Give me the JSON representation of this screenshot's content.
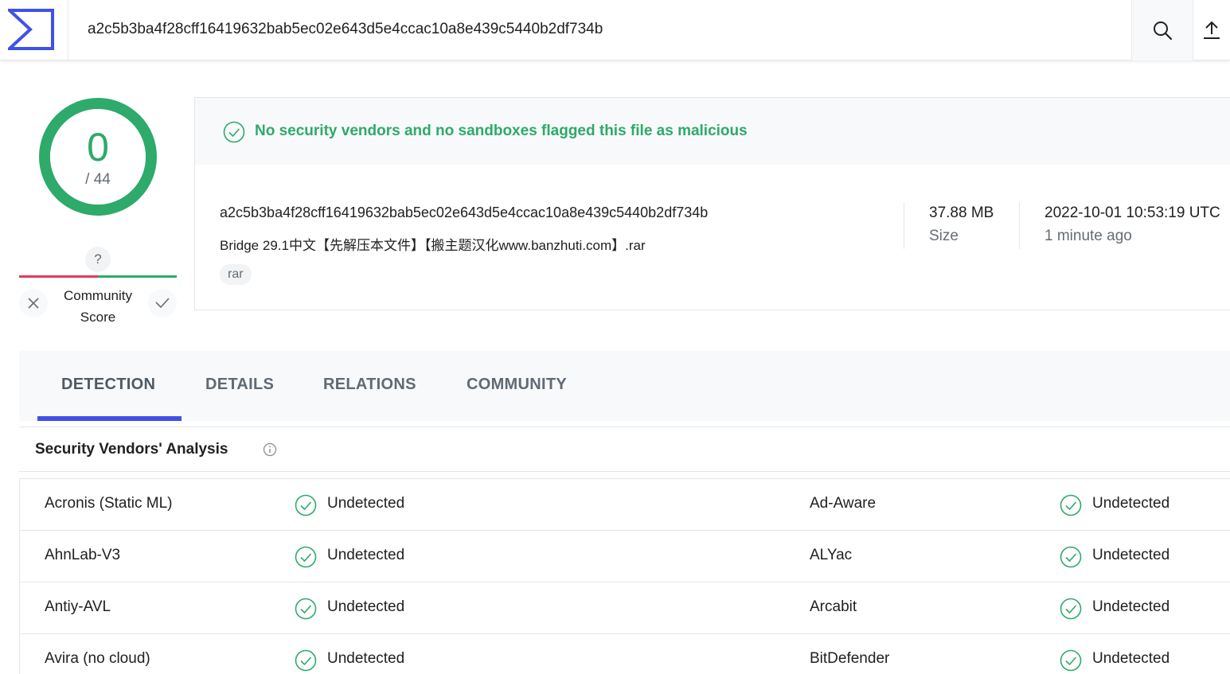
{
  "search": {
    "query": "a2c5b3ba4f28cff16419632bab5ec02e643d5e4ccac10a8e439c5440b2df734b"
  },
  "score": {
    "detections": "0",
    "total": "/ 44",
    "community_question": "?",
    "community_label_line1": "Community",
    "community_label_line2": "Score"
  },
  "banner": {
    "text": "No security vendors and no sandboxes flagged this file as malicious"
  },
  "file": {
    "hash": "a2c5b3ba4f28cff16419632bab5ec02e643d5e4ccac10a8e439c5440b2df734b",
    "name": "Bridge 29.1中文【先解压本文件】【搬主题汉化www.banzhuti.com】.rar",
    "tag": "rar",
    "size_value": "37.88 MB",
    "size_label": "Size",
    "date_value": "2022-10-01 10:53:19 UTC",
    "date_label": "1 minute ago"
  },
  "tabs": [
    {
      "label": "DETECTION"
    },
    {
      "label": "DETAILS"
    },
    {
      "label": "RELATIONS"
    },
    {
      "label": "COMMUNITY"
    }
  ],
  "analysis": {
    "title": "Security Vendors' Analysis",
    "rows": [
      {
        "vendor_a": "Acronis (Static ML)",
        "result_a": "Undetected",
        "vendor_b": "Ad-Aware",
        "result_b": "Undetected"
      },
      {
        "vendor_a": "AhnLab-V3",
        "result_a": "Undetected",
        "vendor_b": "ALYac",
        "result_b": "Undetected"
      },
      {
        "vendor_a": "Antiy-AVL",
        "result_a": "Undetected",
        "vendor_b": "Arcabit",
        "result_b": "Undetected"
      },
      {
        "vendor_a": "Avira (no cloud)",
        "result_a": "Undetected",
        "vendor_b": "BitDefender",
        "result_b": "Undetected"
      }
    ]
  },
  "colors": {
    "accent": "#3f51e8",
    "clean_green": "#2eaa6a",
    "negative_red": "#e33a5a"
  },
  "icons": {
    "logo": "virustotal-sigma-logo",
    "search": "search-icon",
    "upload": "upload-icon",
    "check": "check-circle-icon",
    "info": "info-icon",
    "close": "close-icon"
  }
}
